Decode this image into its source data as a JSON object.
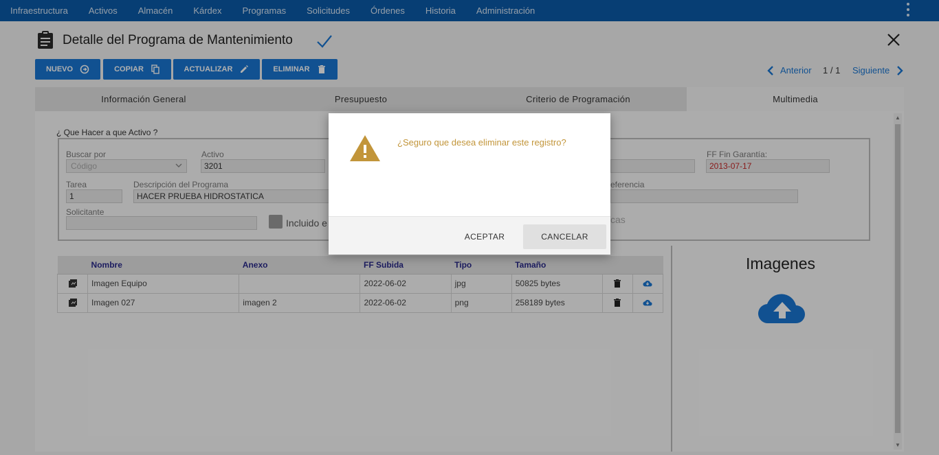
{
  "colors": {
    "nav_bg": "#0b5aa8",
    "primary": "#1976d2",
    "warning": "#c2953a",
    "expired_date": "#c62828"
  },
  "topnav": {
    "items": [
      "Infraestructura",
      "Activos",
      "Almacén",
      "Kárdex",
      "Programas",
      "Solicitudes",
      "Órdenes",
      "Historia",
      "Administración"
    ],
    "menu_icon": "more-vert-icon"
  },
  "header": {
    "title": "Detalle del Programa de Mantenimiento",
    "title_icon": "clipboard-icon",
    "status_icon": "check-icon",
    "close_icon": "close-icon"
  },
  "toolbar": {
    "nuevo": "NUEVO",
    "copiar": "COPIAR",
    "actualizar": "ACTUALIZAR",
    "eliminar": "ELIMINAR"
  },
  "pager": {
    "prev": "Anterior",
    "count": "1 / 1",
    "next": "Siguiente"
  },
  "tabs": [
    "Información General",
    "Presupuesto",
    "Criterio de Programación",
    "Multimedia"
  ],
  "active_tab": "Multimedia",
  "form": {
    "section_title": "¿ Que Hacer a que Activo ?",
    "buscar_por_label": "Buscar por",
    "buscar_por_value": "Código",
    "activo_label": "Activo",
    "activo_value": "3201",
    "ff_fin_garantia_label": "FF Fin Garantía:",
    "ff_fin_garantia_value": "2013-07-17",
    "tarea_label": "Tarea",
    "tarea_value": "1",
    "descripcion_label": "Descripción del Programa",
    "descripcion_value": "HACER PRUEBA HIDROSTATICA",
    "referencia_label_partial": "eferencia",
    "solicitante_label": "Solicitante",
    "solicitante_value": "",
    "incluido_label_partial": "Incluido e",
    "hidden_label_partial": "cas"
  },
  "files_table": {
    "columns": [
      "Nombre",
      "Anexo",
      "FF Subida",
      "Tipo",
      "Tamaño"
    ],
    "rows": [
      {
        "nombre": "Imagen Equipo",
        "anexo": "",
        "ff_subida": "2022-06-02",
        "tipo": "jpg",
        "tamano": "50825 bytes"
      },
      {
        "nombre": "Imagen 027",
        "anexo": "imagen 2",
        "ff_subida": "2022-06-02",
        "tipo": "png",
        "tamano": "258189 bytes"
      }
    ]
  },
  "images_panel": {
    "title": "Imagenes",
    "upload_icon": "cloud-upload-icon"
  },
  "modal": {
    "icon": "warning-icon",
    "message": "¿Seguro que desea eliminar este registro?",
    "accept": "ACEPTAR",
    "cancel": "CANCELAR"
  }
}
